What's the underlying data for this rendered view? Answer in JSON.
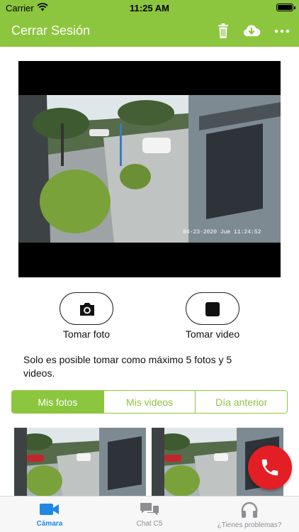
{
  "status_bar": {
    "carrier": "Carrier",
    "time": "11:25 AM"
  },
  "nav": {
    "title": "Cerrar Sesión",
    "icons": [
      "trash-icon",
      "cloud-download-icon",
      "more-icon"
    ]
  },
  "camera": {
    "overlay_text": "04-23-2020 Jue 11:24:52"
  },
  "actions": {
    "photo_label": "Tomar foto",
    "video_label": "Tomar video"
  },
  "info_text": "Solo es posible tomar como máximo 5 fotos y 5 videos.",
  "segments": {
    "items": [
      {
        "label": "Mis fotos",
        "active": true
      },
      {
        "label": "Mis videos",
        "active": false
      },
      {
        "label": "Día anterior",
        "active": false
      }
    ]
  },
  "tab_bar": {
    "items": [
      {
        "label": "Cámara",
        "icon": "video-camera-icon",
        "active": true
      },
      {
        "label": "Chat C5",
        "icon": "chat-icon",
        "active": false
      },
      {
        "label": "¿Tienes problemas?",
        "icon": "headphones-icon",
        "active": false
      }
    ]
  },
  "colors": {
    "brand_green": "#8cc63e",
    "call_red": "#e31e24",
    "tab_active_blue": "#1e88e5"
  }
}
